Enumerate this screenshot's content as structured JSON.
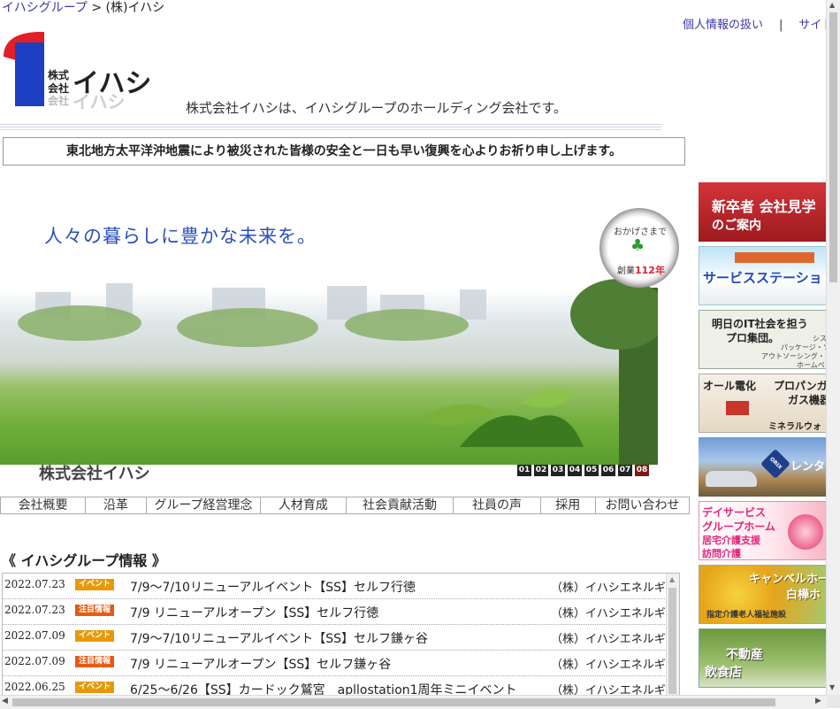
{
  "breadcrumb": {
    "parent": "イハシグループ",
    "sep": ">",
    "current": "(株)イハシ"
  },
  "top_links": {
    "privacy": "個人情報の扱い",
    "sep": "|",
    "sitemap": "サイト"
  },
  "header": {
    "tagline": "株式会社イハシは、イハシグループのホールディング会社です。"
  },
  "notice": "東北地方太平洋沖地震により被災された皆様の安全と一日も早い復興を心よりお祈り申し上げます。",
  "hero": {
    "headline": "人々の暮らしに豊かな未来を。",
    "badge_line1": "おかげさまで",
    "badge_line2": "創業",
    "badge_years": "112年",
    "company": "株式会社イハシ",
    "pages": [
      "01",
      "02",
      "03",
      "04",
      "05",
      "06",
      "07",
      "08"
    ],
    "active_page": "08"
  },
  "nav": [
    "会社概要",
    "沿革",
    "グループ経営理念",
    "人材育成",
    "社会貢献活動",
    "社員の声",
    "採用",
    "お問い合わせ"
  ],
  "info_title": "《 イハシグループ情報 》",
  "news": [
    {
      "date": "2022.07.23",
      "badge": "イベント",
      "type": "event",
      "title": "7/9～7/10リニューアルイベント【SS】セルフ行徳",
      "company": "（株）イハシエネルギー"
    },
    {
      "date": "2022.07.23",
      "badge": "注目情報",
      "type": "notice",
      "title": "7/9 リニューアルオープン【SS】セルフ行徳",
      "company": "（株）イハシエネルギー"
    },
    {
      "date": "2022.07.09",
      "badge": "イベント",
      "type": "event",
      "title": "7/9～7/10リニューアルイベント【SS】セルフ鎌ヶ谷",
      "company": "（株）イハシエネルギー"
    },
    {
      "date": "2022.07.09",
      "badge": "注目情報",
      "type": "notice",
      "title": "7/9 リニューアルオープン【SS】セルフ鎌ヶ谷",
      "company": "（株）イハシエネルギー"
    },
    {
      "date": "2022.06.25",
      "badge": "イベント",
      "type": "event",
      "title": "6/25～6/26【SS】カードック鷲宮　apllostation1周年ミニイベント",
      "company": "（株）イハシエネルギー"
    }
  ],
  "sidebar": [
    {
      "line1": "新卒者 会社見学",
      "line2": "のご案内"
    },
    {
      "line1": "サービスステーショ"
    },
    {
      "line1": "明日のIT社会を担う",
      "line2": "プロ集団。",
      "line3": "シス",
      "line4": "パッケージ・ソ",
      "line5": "アウトソーシング・",
      "line6": "ホームペ"
    },
    {
      "line1": "オール電化",
      "line2": "プロパンガ",
      "line3": "ガス機器",
      "line4": "ミネラルウォ"
    },
    {
      "line1": "ORIX",
      "line2": "レンタ"
    },
    {
      "line1": "デイサービス",
      "line2": "グループホーム",
      "line3": "居宅介護支援",
      "line4": "訪問介護"
    },
    {
      "line1": "キャンベルホー",
      "line2": "白樺ホ",
      "line3": "指定介護老人福祉施設"
    },
    {
      "line1": "不動産",
      "line2": "飲食店"
    }
  ],
  "colors": {
    "link": "#3a3aa8",
    "headline": "#2a4fbf",
    "logo_red": "#e01f26",
    "logo_blue": "#1d3fc4",
    "badge_event": "#e69a0a",
    "badge_notice": "#e35b15"
  }
}
